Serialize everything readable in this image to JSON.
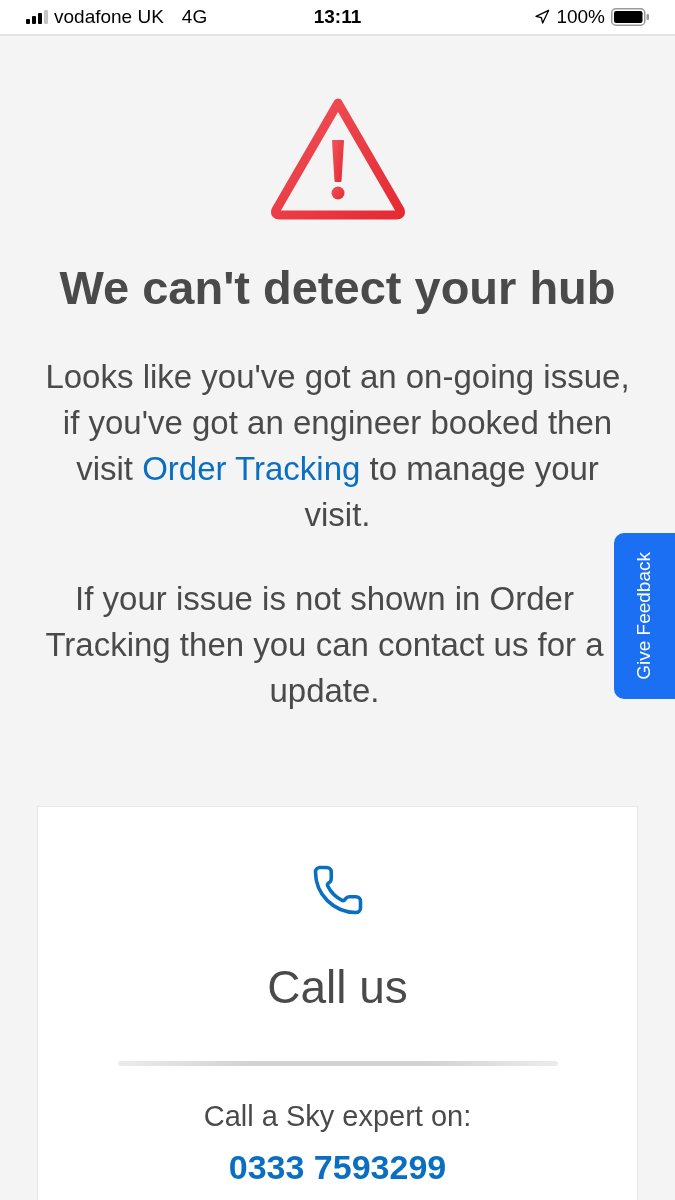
{
  "status_bar": {
    "carrier": "vodafone UK",
    "network": "4G",
    "time": "13:11",
    "battery": "100%"
  },
  "error": {
    "title": "We can't detect your hub",
    "paragraphs": [
      [
        {
          "kind": "text",
          "text": "Looks like you've got an on-going issue, if you've got an engineer booked then visit "
        },
        {
          "kind": "link",
          "text": "Order Tracking"
        },
        {
          "kind": "text",
          "text": " to manage your visit."
        }
      ],
      [
        {
          "kind": "text",
          "text": "If your issue is not shown in Order Tracking then you can contact us for a update."
        }
      ]
    ]
  },
  "feedback_tab": {
    "label": "Give Feedback"
  },
  "contact_card": {
    "title": "Call us",
    "prompt": "Call a Sky expert on:",
    "phone": "0333 7593299"
  }
}
